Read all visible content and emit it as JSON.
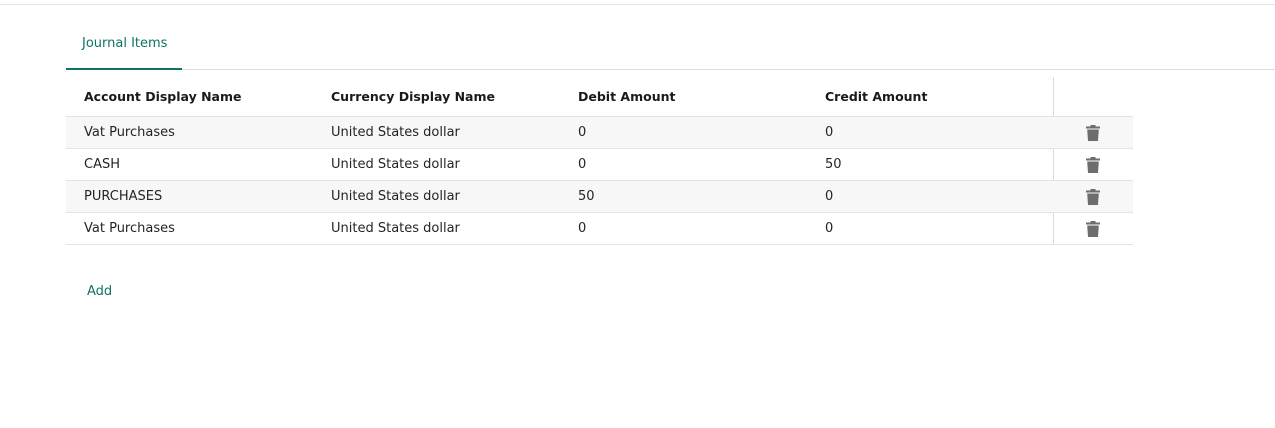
{
  "tabs": [
    {
      "label": "Journal Items",
      "active": true
    }
  ],
  "table": {
    "columns": [
      "Account Display Name",
      "Currency Display Name",
      "Debit Amount",
      "Credit Amount"
    ],
    "rows": [
      {
        "account": "Vat Purchases",
        "currency": "United States dollar",
        "debit": "0",
        "credit": "0"
      },
      {
        "account": "CASH",
        "currency": "United States dollar",
        "debit": "0",
        "credit": "50"
      },
      {
        "account": "PURCHASES",
        "currency": "United States dollar",
        "debit": "50",
        "credit": "0"
      },
      {
        "account": "Vat Purchases",
        "currency": "United States dollar",
        "debit": "0",
        "credit": "0"
      }
    ],
    "row_action_icon": "trash-icon"
  },
  "add_label": "Add",
  "colors": {
    "accent": "#0e7364",
    "stripe": "#f7f7f7",
    "icon": "#6d6d6d"
  }
}
